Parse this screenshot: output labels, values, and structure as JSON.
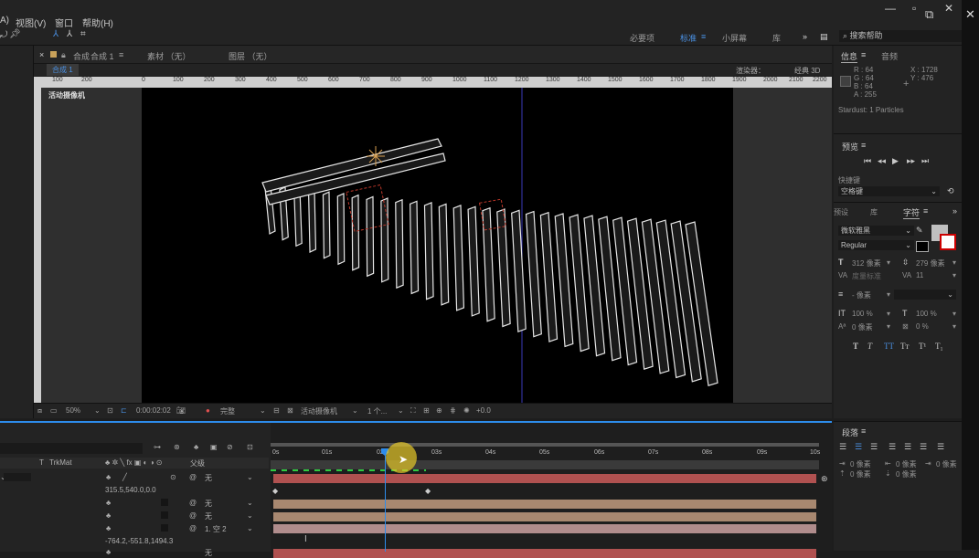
{
  "menu": {
    "item_a": "A)",
    "view": "视图(V)",
    "window": "窗口",
    "help": "帮助(H)"
  },
  "toolbar": {
    "workspaces": [
      "必要项",
      "标准",
      "小屏幕",
      "库"
    ],
    "active_workspace": "标准",
    "search_placeholder": "搜索帮助"
  },
  "comp_panel": {
    "tab_prefix": "合成",
    "tab_name": "合成 1",
    "footage_tab": "素材 （无）",
    "layer_tab": "图层 （无）",
    "breadcrumb": "合成 1",
    "renderer_label": "渲染器：",
    "renderer_value": "经典 3D",
    "camera_label": "活动摄像机",
    "ruler_ticks": [
      "100",
      "200",
      "0",
      "100",
      "200",
      "300",
      "400",
      "500",
      "600",
      "700",
      "800",
      "900",
      "1000",
      "1100",
      "1200",
      "1300",
      "1400",
      "1500",
      "1600",
      "1700",
      "1800",
      "1900",
      "2000",
      "2100",
      "2200"
    ]
  },
  "viewer_bar": {
    "zoom": "50%",
    "timecode": "0:00:02:02",
    "resolution": "完整",
    "view": "活动摄像机",
    "views": "1 个...",
    "exposure": "+0.0"
  },
  "info_panel": {
    "tab_info": "信息",
    "tab_audio": "音频",
    "r": "R : 64",
    "g": "G : 64",
    "b": "B : 64",
    "a": "A : 255",
    "x": "X : 1728",
    "y": "Y : 476",
    "status": "Stardust: 1 Particles"
  },
  "preview_panel": {
    "title": "预览",
    "shortcut_label": "快捷键",
    "shortcut_value": "空格键"
  },
  "char_panel": {
    "tab_presets": "预设",
    "tab_library": "库",
    "tab_char": "字符",
    "font": "微软雅黑",
    "style": "Regular",
    "font_size": "312 像素",
    "leading": "279 像素",
    "kerning": "度量标准",
    "tracking": "11",
    "stroke_width": "- 像素",
    "vscale": "100 %",
    "hscale": "100 %",
    "baseline": "0 像素",
    "tsume": "0 %",
    "style_buttons": [
      "T",
      "T",
      "TT",
      "Tт",
      "T¹",
      "T₁"
    ]
  },
  "paragraph_panel": {
    "title": "段落",
    "indent_values": [
      "0 像素",
      "0 像素",
      "0 像素",
      "0 像素",
      "0 像素"
    ]
  },
  "timeline": {
    "column_trkmat": "TrkMat",
    "column_t": "T",
    "parent_header": "父级",
    "ruler_labels": [
      "0s",
      "01s",
      "02s",
      "03s",
      "04s",
      "05s",
      "06s",
      "07s",
      "08s",
      "09s",
      "10s"
    ],
    "playhead": "02s",
    "rows": [
      {
        "parent": "无"
      },
      {
        "value": "315.5,540.0,0.0"
      },
      {
        "parent": "无"
      },
      {
        "parent": "无"
      },
      {
        "parent": "1. 空 2"
      },
      {
        "value": "-764.2,-551.8,1494.3"
      },
      {
        "parent": "无"
      }
    ],
    "colors": {
      "red": "#b05150",
      "tan": "#a88870",
      "pink": "#b08c8c",
      "accent": "#2d8ceb"
    }
  }
}
